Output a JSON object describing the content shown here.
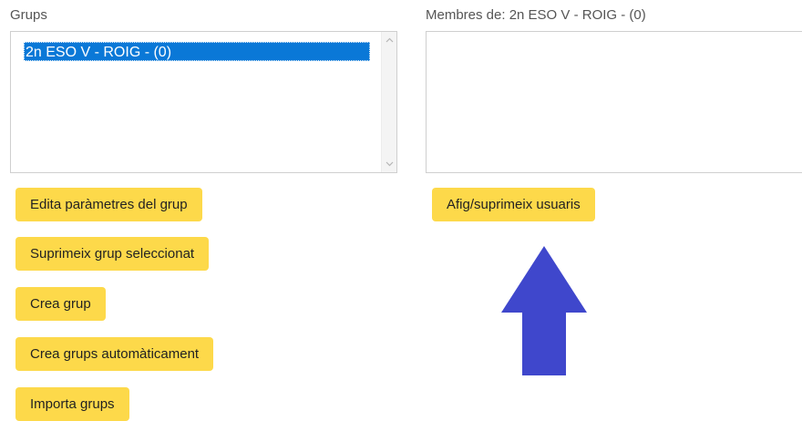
{
  "groups_panel": {
    "label": "Grups",
    "selected_group": "2n ESO V - ROIG - (0)"
  },
  "members_panel": {
    "label": "Membres de: 2n ESO V - ROIG - (0)"
  },
  "buttons": {
    "edit_group": "Edita paràmetres del grup",
    "delete_group": "Suprimeix grup seleccionat",
    "create_group": "Crea grup",
    "create_auto": "Crea grups automàticament",
    "import_groups": "Importa grups",
    "add_remove_users": "Afig/suprimeix usuaris"
  },
  "colors": {
    "button_bg": "#fdd94a",
    "selection_bg": "#0a78d7",
    "arrow": "#3f47cc"
  },
  "icons": {
    "scroll_up": "chevron-up-icon",
    "scroll_down": "chevron-down-icon",
    "annotation": "arrow-up-icon"
  }
}
